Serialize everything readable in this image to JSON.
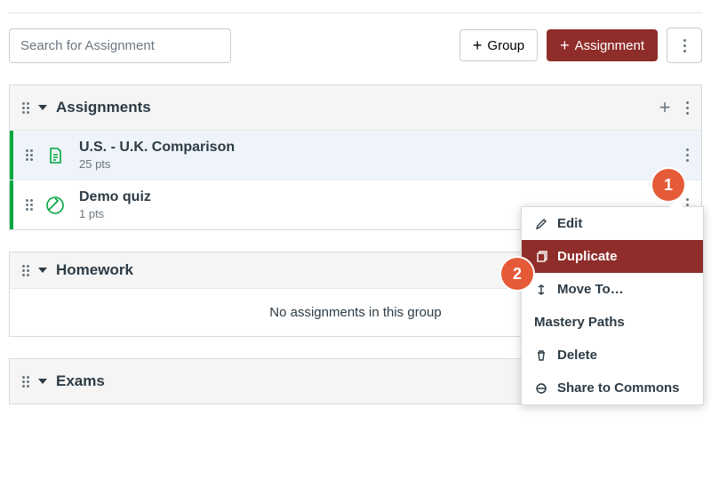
{
  "search": {
    "placeholder": "Search for Assignment"
  },
  "buttons": {
    "group": "Group",
    "assignment": "Assignment"
  },
  "groups": [
    {
      "title": "Assignments",
      "empty": false,
      "items": [
        {
          "title": "U.S. - U.K. Comparison",
          "meta": "25 pts",
          "icon": "assignment",
          "selected": true
        },
        {
          "title": "Demo quiz",
          "meta": "1 pts",
          "icon": "quiz",
          "selected": false
        }
      ]
    },
    {
      "title": "Homework",
      "empty": true,
      "empty_label": "No assignments in this group",
      "items": []
    },
    {
      "title": "Exams",
      "empty": false,
      "items": []
    }
  ],
  "menu": {
    "edit": "Edit",
    "duplicate": "Duplicate",
    "move_to": "Move To…",
    "mastery_paths": "Mastery Paths",
    "delete": "Delete",
    "share_commons": "Share to Commons"
  },
  "callouts": {
    "one": "1",
    "two": "2"
  }
}
